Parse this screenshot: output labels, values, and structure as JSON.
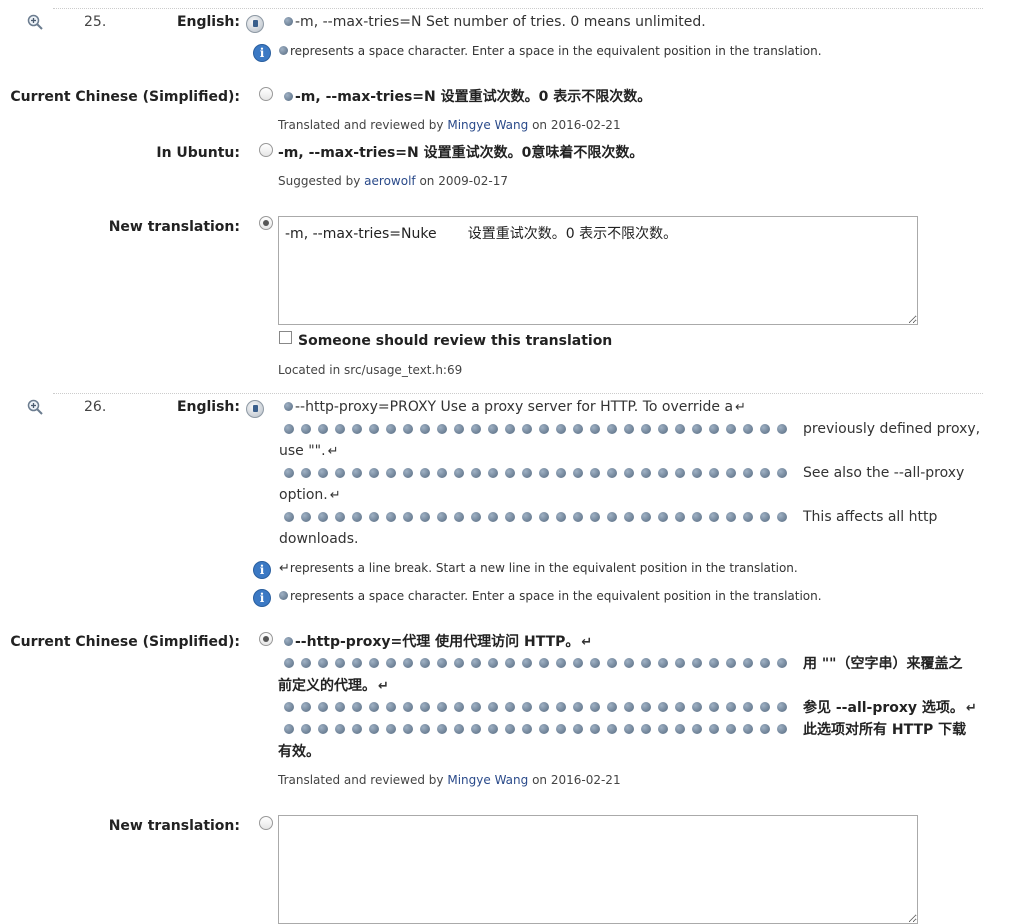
{
  "messages": [
    {
      "number": "25.",
      "english_label": "English:",
      "english_text": "-m, --max-tries=N Set number of tries. 0 means unlimited.",
      "space_note": "represents a space character. Enter a space in the equivalent position in the translation.",
      "current_label": "Current Chinese (Simplified):",
      "current_text": "-m, --max-tries=N 设置重试次数。0 表示不限次数。",
      "current_meta": {
        "prefix": "Translated and reviewed by",
        "author": "Mingye Wang",
        "suffix": "on 2016-02-21"
      },
      "ubuntu_label": "In Ubuntu:",
      "ubuntu_text": "-m, --max-tries=N 设置重试次数。0意味着不限次数。",
      "ubuntu_meta": {
        "prefix": "Suggested by",
        "author": "aerowolf",
        "suffix": "on 2009-02-17"
      },
      "new_label": "New translation:",
      "new_value": "-m, --max-tries=Nuke       设置重试次数。0 表示不限次数。",
      "review_label": "Someone should review this translation",
      "located": "Located in src/usage_text.h:69"
    },
    {
      "number": "26.",
      "english_label": "English:",
      "english_line1": "--http-proxy=PROXY Use a proxy server for HTTP. To override a",
      "english_line2a": "previously defined proxy,",
      "english_line2b": "use \"\".",
      "english_line3a": "See also the --all-proxy",
      "english_line3b": "option.",
      "english_line4a": "This affects all http",
      "english_line4b": "downloads.",
      "linebreak_note": "represents a line break. Start a new line in the equivalent position in the translation.",
      "space_note": "represents a space character. Enter a space in the equivalent position in the translation.",
      "current_label": "Current Chinese (Simplified):",
      "current_line1": "--http-proxy=代理 使用代理访问 HTTP。",
      "current_line2a": "用 \"\"（空字串）来覆盖之",
      "current_line2b": "前定义的代理。",
      "current_line3a": "参见 --all-proxy 选项。",
      "current_line4a": "此选项对所有 HTTP 下载",
      "current_line4b": "有效。",
      "current_meta": {
        "prefix": "Translated and reviewed by",
        "author": "Mingye Wang",
        "suffix": "on 2016-02-21"
      },
      "new_label": "New translation:",
      "new_value": ""
    }
  ],
  "icons": {
    "zoom": "zoom-in-icon",
    "copy": "copy-text-icon",
    "info": "info-icon",
    "space": "space-marker-icon",
    "return": "line-break-icon"
  },
  "colors": {
    "link": "#2a4a8a",
    "info": "#3b79c4"
  }
}
